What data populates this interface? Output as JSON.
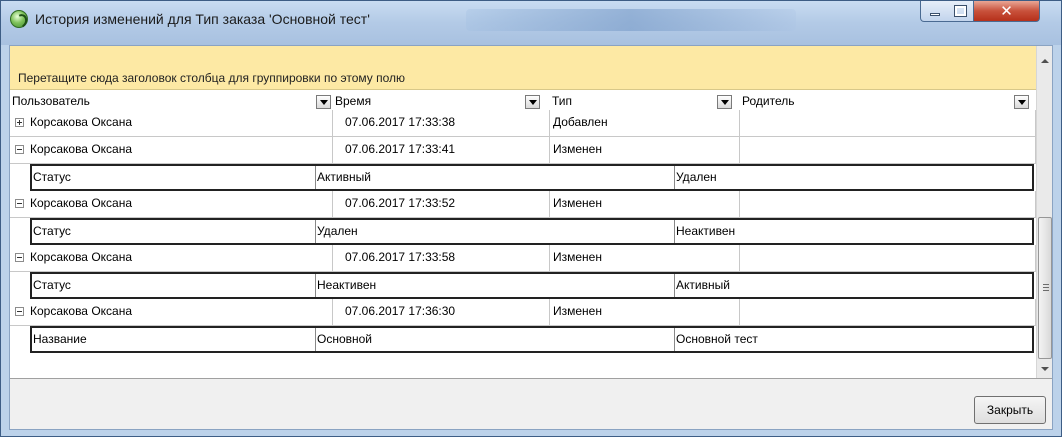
{
  "window": {
    "title": "История изменений для Тип заказа 'Основной тест'",
    "icon": "app-icon",
    "controls": {
      "minimize": "minimize-icon",
      "maximize": "maximize-icon",
      "close_glyph": "✕"
    }
  },
  "grid": {
    "group_panel_text": "Перетащите сюда заголовок столбца для группировки по этому полю",
    "columns": [
      "Пользователь",
      "Время",
      "Тип",
      "Родитель"
    ],
    "rows": [
      {
        "user": "Корсакова Оксана",
        "time": "07.06.2017 17:33:38",
        "type": "Добавлен",
        "parent": "",
        "expanded": false
      },
      {
        "user": "Корсакова Оксана",
        "time": "07.06.2017 17:33:41",
        "type": "Изменен",
        "parent": "",
        "expanded": true,
        "detail": {
          "field": "Статус",
          "old": "Активный",
          "new": "Удален"
        }
      },
      {
        "user": "Корсакова Оксана",
        "time": "07.06.2017 17:33:52",
        "type": "Изменен",
        "parent": "",
        "expanded": true,
        "detail": {
          "field": "Статус",
          "old": "Удален",
          "new": "Неактивен"
        }
      },
      {
        "user": "Корсакова Оксана",
        "time": "07.06.2017 17:33:58",
        "type": "Изменен",
        "parent": "",
        "expanded": true,
        "detail": {
          "field": "Статус",
          "old": "Неактивен",
          "new": "Активный"
        }
      },
      {
        "user": "Корсакова Оксана",
        "time": "07.06.2017 17:36:30",
        "type": "Изменен",
        "parent": "",
        "expanded": true,
        "detail": {
          "field": "Название",
          "old": "Основной",
          "new": "Основной тест"
        }
      }
    ]
  },
  "footer": {
    "close_label": "Закрыть"
  },
  "colors": {
    "group_panel": "#fde9a4",
    "window_frame": "#bcd2ea",
    "close_button": "#c8513b"
  }
}
